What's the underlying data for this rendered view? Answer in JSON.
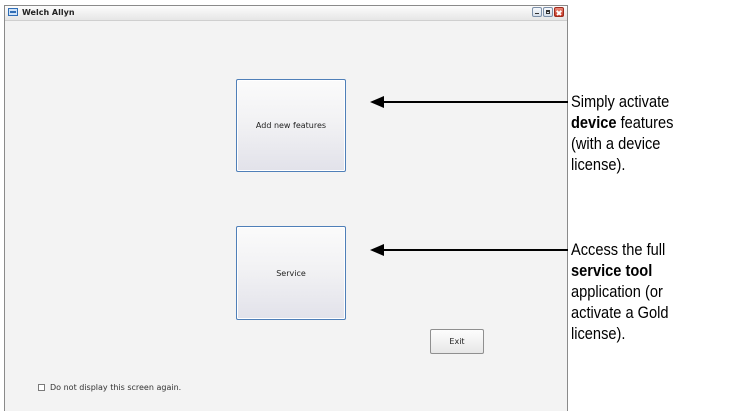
{
  "window": {
    "title": "Welch Allyn"
  },
  "main": {
    "add_features_label": "Add new features",
    "service_label": "Service",
    "exit_label": "Exit",
    "dont_display_label": "Do not display this screen again.",
    "dont_display_checked": false
  },
  "annotations": {
    "callout_1": {
      "before": "Simply activate",
      "bold": "device",
      "after": "features (with a device license)."
    },
    "callout_2": {
      "before": "Access the full",
      "bold": "service tool",
      "after": "application (or activate a Gold license)."
    }
  }
}
